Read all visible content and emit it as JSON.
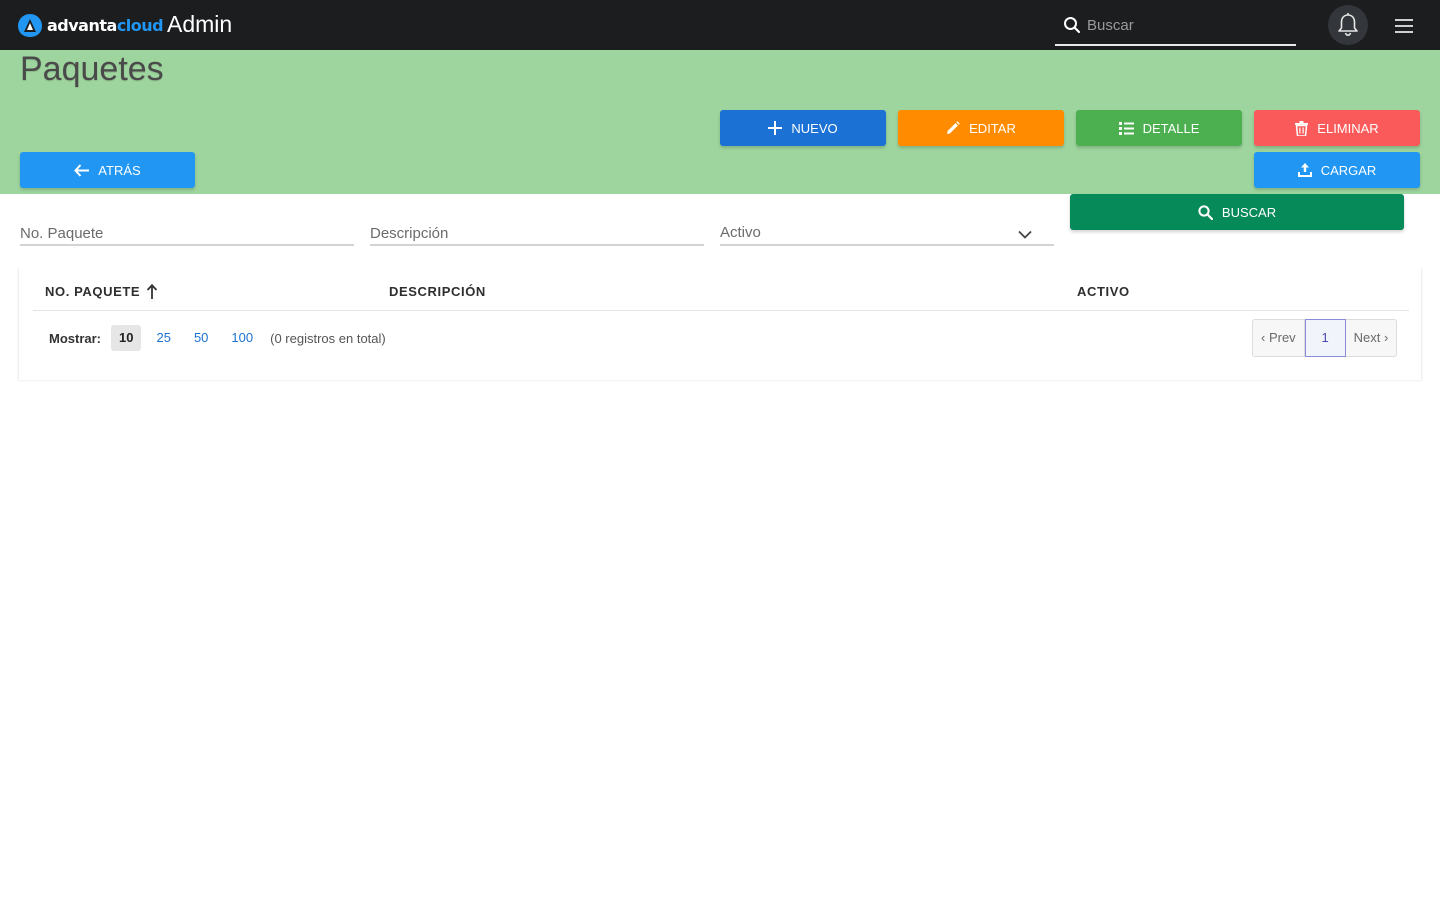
{
  "brand": {
    "name_part1": "advanta",
    "name_part2": "cloud",
    "app_title": "Admin",
    "accent": "#2196f3"
  },
  "topbar": {
    "search_placeholder": "Buscar"
  },
  "page": {
    "title": "Paquetes"
  },
  "actions": {
    "nuevo": "NUEVO",
    "editar": "EDITAR",
    "detalle": "DETALLE",
    "eliminar": "ELIMINAR",
    "atras": "ATRÁS",
    "cargar": "CARGAR",
    "buscar": "BUSCAR"
  },
  "filters": {
    "paquete_placeholder": "No. Paquete",
    "descripcion_placeholder": "Descripción",
    "activo_label": "Activo"
  },
  "table": {
    "columns": [
      "NO. PAQUETE",
      "DESCRIPCIÓN",
      "ACTIVO"
    ],
    "sort_column": "NO. PAQUETE",
    "sort_direction": "ascending",
    "rows": []
  },
  "pager": {
    "show_label": "Mostrar:",
    "sizes": [
      "10",
      "25",
      "50",
      "100"
    ],
    "selected_size": "10",
    "total_text": "(0 registros en total)",
    "prev": "‹ Prev",
    "current_page": "1",
    "next": "Next ›"
  },
  "colors": {
    "topbar": "#1c1d1f",
    "header": "#9ed59e",
    "nuevo": "#1c72d4",
    "editar": "#ff8c00",
    "detalle": "#4caf50",
    "eliminar": "#fb5a5a",
    "atras": "#2196f3",
    "cargar": "#2196f3",
    "buscar": "#078a5a"
  }
}
